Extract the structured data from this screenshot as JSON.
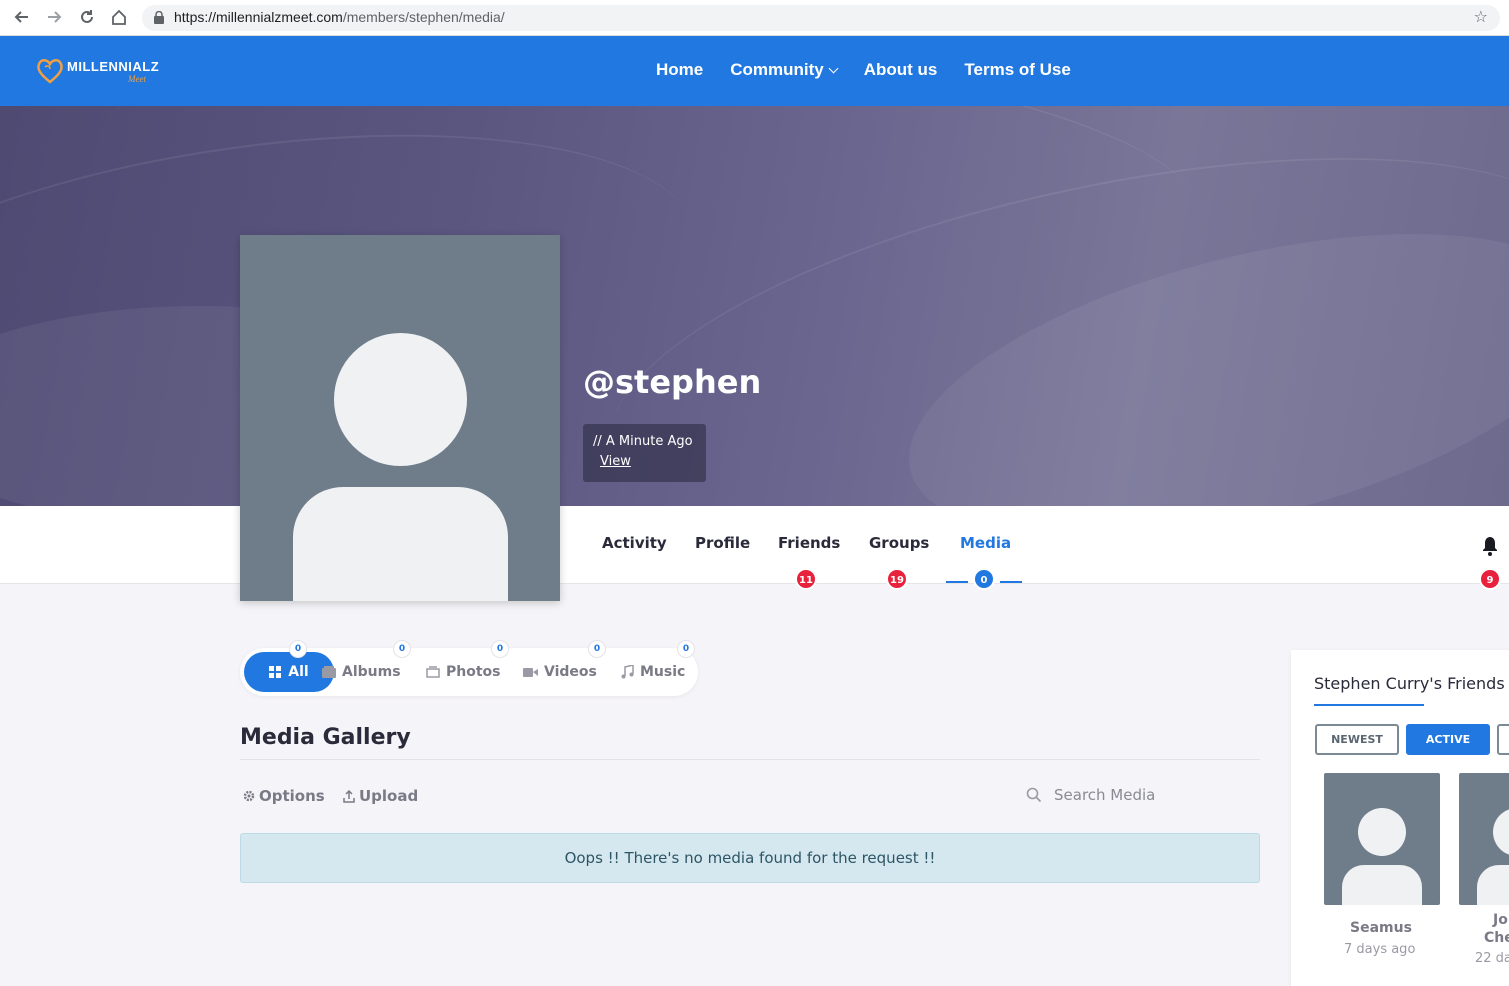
{
  "browser": {
    "url_host": "https://millennialzmeet.com",
    "url_path": "/members/stephen/media/"
  },
  "site": {
    "logo_text": "MILLENNIALZ",
    "logo_sub": "Meet",
    "nav": [
      {
        "label": "Home"
      },
      {
        "label": "Community"
      },
      {
        "label": "About us"
      },
      {
        "label": "Terms of Use"
      }
    ]
  },
  "profile": {
    "username": "@stephen",
    "last_active": "// A Minute Ago",
    "view_label": "View"
  },
  "tabs": [
    {
      "label": "Activity"
    },
    {
      "label": "Profile"
    },
    {
      "label": "Friends",
      "count": "11"
    },
    {
      "label": "Groups",
      "count": "19"
    },
    {
      "label": "Media",
      "count": "0"
    }
  ],
  "notifications": {
    "count": "9"
  },
  "media": {
    "subnav": [
      {
        "label": "All",
        "count": "0",
        "icon": "grid-icon"
      },
      {
        "label": "Albums",
        "count": "0",
        "icon": "album-icon"
      },
      {
        "label": "Photos",
        "count": "0",
        "icon": "photo-icon"
      },
      {
        "label": "Videos",
        "count": "0",
        "icon": "video-icon"
      },
      {
        "label": "Music",
        "count": "0",
        "icon": "music-icon"
      }
    ],
    "title": "Media Gallery",
    "options_label": "Options",
    "upload_label": "Upload",
    "search_placeholder": "Search Media",
    "empty_message": "Oops !! There's no media found for the request !!"
  },
  "friends_widget": {
    "title": "Stephen Curry's Friends",
    "filters": [
      {
        "label": "NEWEST"
      },
      {
        "label": "ACTIVE"
      }
    ],
    "friends": [
      {
        "name": "Seamus",
        "time": "7 days ago"
      },
      {
        "name_line1": "Jo",
        "name_line2": "Che",
        "time": "22 da"
      }
    ]
  },
  "colors": {
    "brand_blue": "#2178e0",
    "badge_red": "#e8213c",
    "notice_bg": "#d6e8ef"
  }
}
